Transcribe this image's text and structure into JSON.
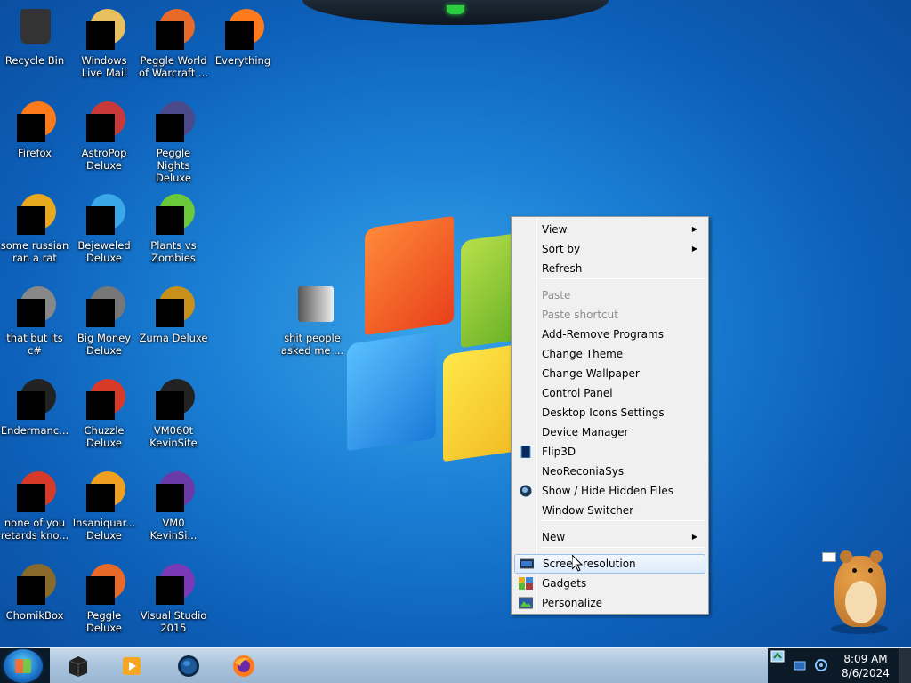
{
  "desktop": {
    "icons": [
      {
        "label": "Recycle Bin",
        "icon": "recycle-bin-icon"
      },
      {
        "label": "Windows Live Mail",
        "icon": "mail-icon"
      },
      {
        "label": "Peggle World of Warcraft ...",
        "icon": "peggle-icon"
      },
      {
        "label": "Everything",
        "icon": "search-icon"
      },
      {
        "label": "Firefox",
        "icon": "firefox-icon"
      },
      {
        "label": "AstroPop Deluxe",
        "icon": "game-icon"
      },
      {
        "label": "Peggle Nights Deluxe",
        "icon": "peggle-icon"
      },
      {
        "label": "some russian ran a rat",
        "icon": "app-icon"
      },
      {
        "label": "Bejeweled Deluxe",
        "icon": "gem-icon"
      },
      {
        "label": "Plants vs Zombies",
        "icon": "plant-icon"
      },
      {
        "label": "that but its c#",
        "icon": "app-icon"
      },
      {
        "label": "Big Money Deluxe",
        "icon": "game-icon"
      },
      {
        "label": "Zuma Deluxe",
        "icon": "game-icon"
      },
      {
        "label": "shit people asked me ...",
        "icon": "folder-icon"
      },
      {
        "label": "Endermanc...",
        "icon": "terminal-icon"
      },
      {
        "label": "Chuzzle Deluxe",
        "icon": "game-icon"
      },
      {
        "label": "VM060t KevinSite",
        "icon": "monitor-icon"
      },
      {
        "label": "none of you retards kno...",
        "icon": "app-icon"
      },
      {
        "label": "Insaniquar... Deluxe",
        "icon": "fish-icon"
      },
      {
        "label": "VM0 KevinSi...",
        "icon": "app-icon"
      },
      {
        "label": "ChomikBox",
        "icon": "box-icon"
      },
      {
        "label": "Peggle Deluxe",
        "icon": "peggle-icon"
      },
      {
        "label": "Visual Studio 2015",
        "icon": "visual-studio-icon"
      }
    ]
  },
  "context_menu": {
    "items": [
      {
        "label": "View",
        "submenu": true
      },
      {
        "label": "Sort by",
        "submenu": true
      },
      {
        "label": "Refresh"
      },
      {
        "label": "Paste",
        "disabled": true
      },
      {
        "label": "Paste shortcut",
        "disabled": true
      },
      {
        "label": "Add-Remove Programs"
      },
      {
        "label": "Change Theme"
      },
      {
        "label": "Change Wallpaper"
      },
      {
        "label": "Control Panel"
      },
      {
        "label": "Desktop Icons Settings"
      },
      {
        "label": "Device Manager"
      },
      {
        "label": "Flip3D",
        "icon": "flip3d-icon"
      },
      {
        "label": "NeoReconiaSys"
      },
      {
        "label": "Show / Hide Hidden Files",
        "icon": "globe-icon"
      },
      {
        "label": "Window Switcher"
      },
      {
        "label": "New",
        "submenu": true
      },
      {
        "label": "Screen resolution",
        "icon": "display-icon",
        "highlighted": true
      },
      {
        "label": "Gadgets",
        "icon": "gadgets-icon"
      },
      {
        "label": "Personalize",
        "icon": "personalize-icon"
      }
    ]
  },
  "taskbar": {
    "pinned": [
      {
        "name": "dark-app",
        "icon": "cube-icon"
      },
      {
        "name": "media-player",
        "icon": "media-player-icon"
      },
      {
        "name": "globe-app",
        "icon": "globe-icon"
      },
      {
        "name": "firefox",
        "icon": "firefox-icon"
      }
    ],
    "clock": {
      "time": "8:09 AM",
      "date": "8/6/2024"
    }
  },
  "colors": {
    "desktop_bg": "#1a7fd4",
    "menu_bg": "#f0f0f0",
    "menu_highlight": "#dcebfc",
    "taskbar": "#a9c3dc"
  }
}
